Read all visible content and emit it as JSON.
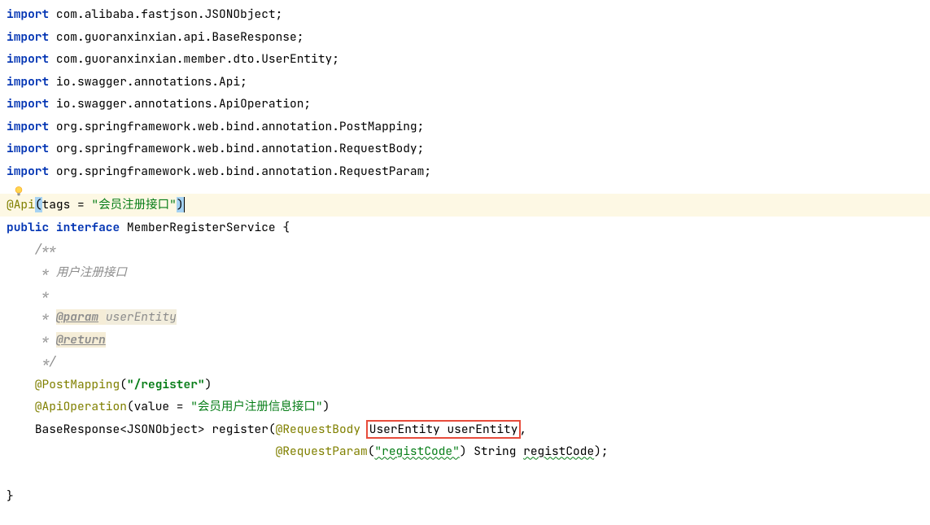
{
  "imports": [
    {
      "keyword": "import",
      "package": "com.alibaba.fastjson.",
      "class": "JSONObject"
    },
    {
      "keyword": "import",
      "package": "com.guoranxinxian.api.",
      "class": "BaseResponse"
    },
    {
      "keyword": "import",
      "package": "com.guoranxinxian.member.dto.",
      "class": "UserEntity"
    },
    {
      "keyword": "import",
      "package": "io.swagger.annotations.",
      "class": "Api"
    },
    {
      "keyword": "import",
      "package": "io.swagger.annotations.",
      "class": "ApiOperation"
    },
    {
      "keyword": "import",
      "package": "org.springframework.web.bind.annotation.",
      "class": "PostMapping"
    },
    {
      "keyword": "import",
      "package": "org.springframework.web.bind.annotation.",
      "class": "RequestBody"
    },
    {
      "keyword": "import",
      "package": "org.springframework.web.bind.annotation.",
      "class": "RequestParam"
    }
  ],
  "api_annotation": {
    "at": "@Api",
    "param_open": "(",
    "param_key": "tags = ",
    "param_value": "\"会员注册接口\"",
    "param_close": ")"
  },
  "declaration": {
    "public": "public",
    "interface": "interface",
    "name": "MemberRegisterService",
    "brace": "{"
  },
  "doc_comment": {
    "start": "    /**",
    "line1": "     * 用户注册接口",
    "blank": "     *",
    "param_star": "     * ",
    "param_tag": "@param",
    "param_space": " ",
    "param_name": "userEntity",
    "return_star": "     * ",
    "return_tag": "@return",
    "end": "     */"
  },
  "post_mapping": {
    "at": "    @PostMapping",
    "open": "(",
    "value": "\"/register\"",
    "close": ")"
  },
  "api_operation": {
    "at": "    @ApiOperation",
    "open": "(",
    "key": "value = ",
    "value": "\"会员用户注册信息接口\"",
    "close": ")"
  },
  "method_sig": {
    "indent": "    ",
    "return_type_base": "BaseResponse",
    "return_type_open": "<",
    "return_type_generic": "JSONObject",
    "return_type_close": ">",
    "space1": " ",
    "method_name": "register",
    "open": "(",
    "request_body": "@RequestBody",
    "space2": " ",
    "user_entity_type": "UserEntity",
    "space3": " ",
    "user_entity_param": "userEntity",
    "comma": ","
  },
  "method_sig_line2": {
    "indent": "                                      ",
    "request_param": "@RequestParam",
    "open": "(",
    "value": "\"registCode\"",
    "close": ")",
    "space": " ",
    "string_type": "String",
    "space2": " ",
    "param_name": "registCode",
    "close_method": ");"
  },
  "close_brace": "}"
}
